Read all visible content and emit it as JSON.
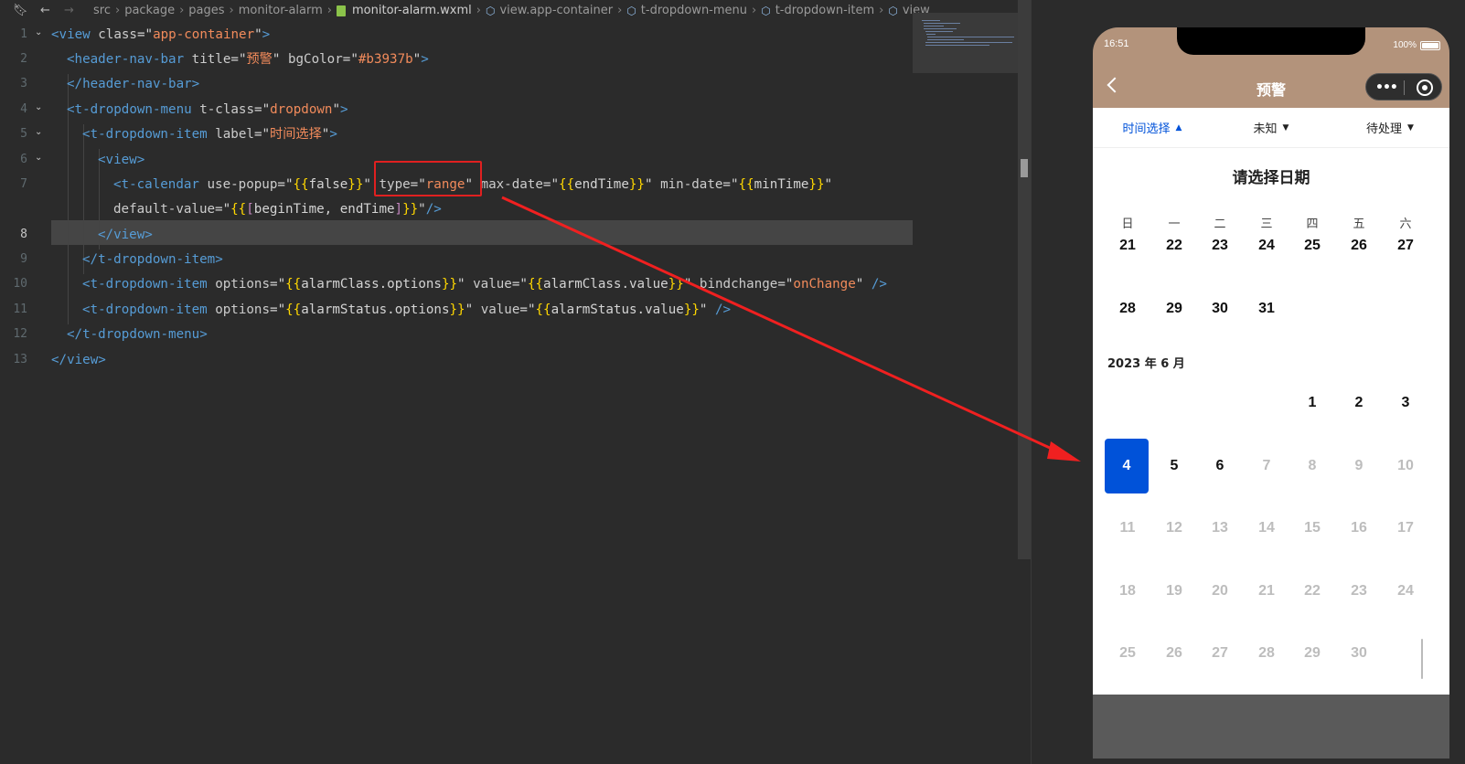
{
  "breadcrumb": {
    "items": [
      "src",
      "package",
      "pages",
      "monitor-alarm",
      "monitor-alarm.wxml",
      "view.app-container",
      "t-dropdown-menu",
      "t-dropdown-item",
      "view"
    ]
  },
  "editor": {
    "line_numbers": [
      "1",
      "2",
      "3",
      "4",
      "5",
      "6",
      "7",
      "",
      "8",
      "9",
      "10",
      "11",
      "12",
      "13"
    ],
    "code_lines": [
      "<view class=\"app-container\">",
      "<header-nav-bar title=\"预警\" bgColor=\"#b3937b\">",
      "</header-nav-bar>",
      "<t-dropdown-menu t-class=\"dropdown\">",
      "<t-dropdown-item label=\"时间选择\">",
      "<view>",
      "<t-calendar use-popup=\"{{false}}\" type=\"range\" max-date=\"{{endTime}}\" min-date=\"{{minTime}}\"",
      "default-value=\"{{[beginTime, endTime]}}\"/>",
      "</view>",
      "</t-dropdown-item>",
      "<t-dropdown-item options=\"{{alarmClass.options}}\" value=\"{{alarmClass.value}}\" bindchange=\"onChange\" />",
      "<t-dropdown-item options=\"{{alarmStatus.options}}\" value=\"{{alarmStatus.value}}\" />",
      "</t-dropdown-menu>",
      "</view>"
    ]
  },
  "phone": {
    "status_time": "16:51",
    "battery": "100%",
    "nav_title": "预警",
    "nav_bg": "#b3937b",
    "dropdowns": [
      {
        "label": "时间选择",
        "arrow": "▲",
        "active": true
      },
      {
        "label": "未知",
        "arrow": "▼",
        "active": false
      },
      {
        "label": "待处理",
        "arrow": "▼",
        "active": false
      }
    ],
    "calendar": {
      "title": "请选择日期",
      "weekdays": [
        "日",
        "一",
        "二",
        "三",
        "四",
        "五",
        "六"
      ],
      "may_rows": [
        [
          "21",
          "22",
          "23",
          "24",
          "25",
          "26",
          "27"
        ],
        [
          "28",
          "29",
          "30",
          "31"
        ]
      ],
      "month_label": "2023 年 6 月",
      "june_rows": [
        [
          "",
          "",
          "",
          "",
          "1",
          "2",
          "3"
        ],
        [
          "4",
          "5",
          "6",
          "7",
          "8",
          "9",
          "10"
        ],
        [
          "11",
          "12",
          "13",
          "14",
          "15",
          "16",
          "17"
        ],
        [
          "18",
          "19",
          "20",
          "21",
          "22",
          "23",
          "24"
        ],
        [
          "25",
          "26",
          "27",
          "28",
          "29",
          "30"
        ]
      ],
      "selected_day": "4",
      "last_enabled_day": "6",
      "accent": "#0052d9"
    }
  }
}
